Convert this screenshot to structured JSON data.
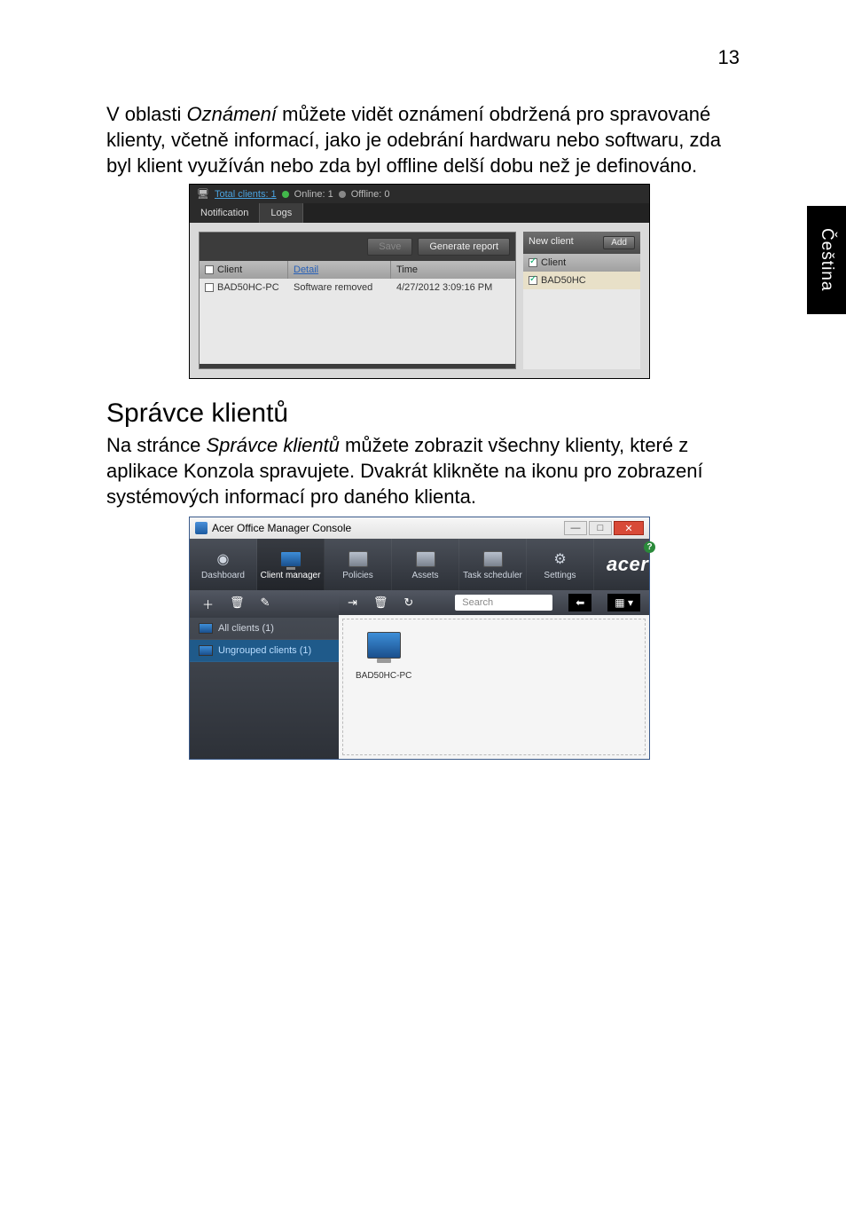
{
  "page_number": "13",
  "side_tab": "Čeština",
  "para1_a": "V oblasti ",
  "para1_i": "Oznámení",
  "para1_b": " můžete vidět oznámení obdržená pro spravované klienty, včetně informací, jako je odebrání hardwaru nebo softwaru, zda byl klient využíván nebo zda byl offline delší dobu než je definováno.",
  "section_heading": "Správce klientů",
  "para2_a": "Na stránce ",
  "para2_i": "Správce klientů",
  "para2_b": " můžete zobrazit všechny klienty, které z aplikace Konzola spravujete. Dvakrát klikněte na ikonu pro zobrazení systémových informací pro daného klienta.",
  "shot1": {
    "total_clients": "Total clients: 1",
    "online": "Online: 1",
    "offline": "Offline: 0",
    "tab_notification": "Notification",
    "tab_logs": "Logs",
    "btn_save": "Save",
    "btn_generate": "Generate report",
    "col_client": "Client",
    "col_detail": "Detail",
    "col_time": "Time",
    "row_client": "BAD50HC-PC",
    "row_detail": "Software removed",
    "row_time": "4/27/2012 3:09:16 PM",
    "new_client": "New client",
    "btn_add": "Add",
    "rc_header": "Client",
    "rc_row": "BAD50HC"
  },
  "shot2": {
    "title": "Acer Office Manager Console",
    "nav": {
      "dashboard": "Dashboard",
      "client_manager": "Client manager",
      "policies": "Policies",
      "assets": "Assets",
      "task_scheduler": "Task scheduler",
      "settings": "Settings"
    },
    "brand": "acer",
    "help": "?",
    "sidebar": {
      "all_clients": "All clients (1)",
      "ungrouped": "Ungrouped clients (1)"
    },
    "search_placeholder": "Search",
    "client_name": "BAD50HC-PC"
  }
}
